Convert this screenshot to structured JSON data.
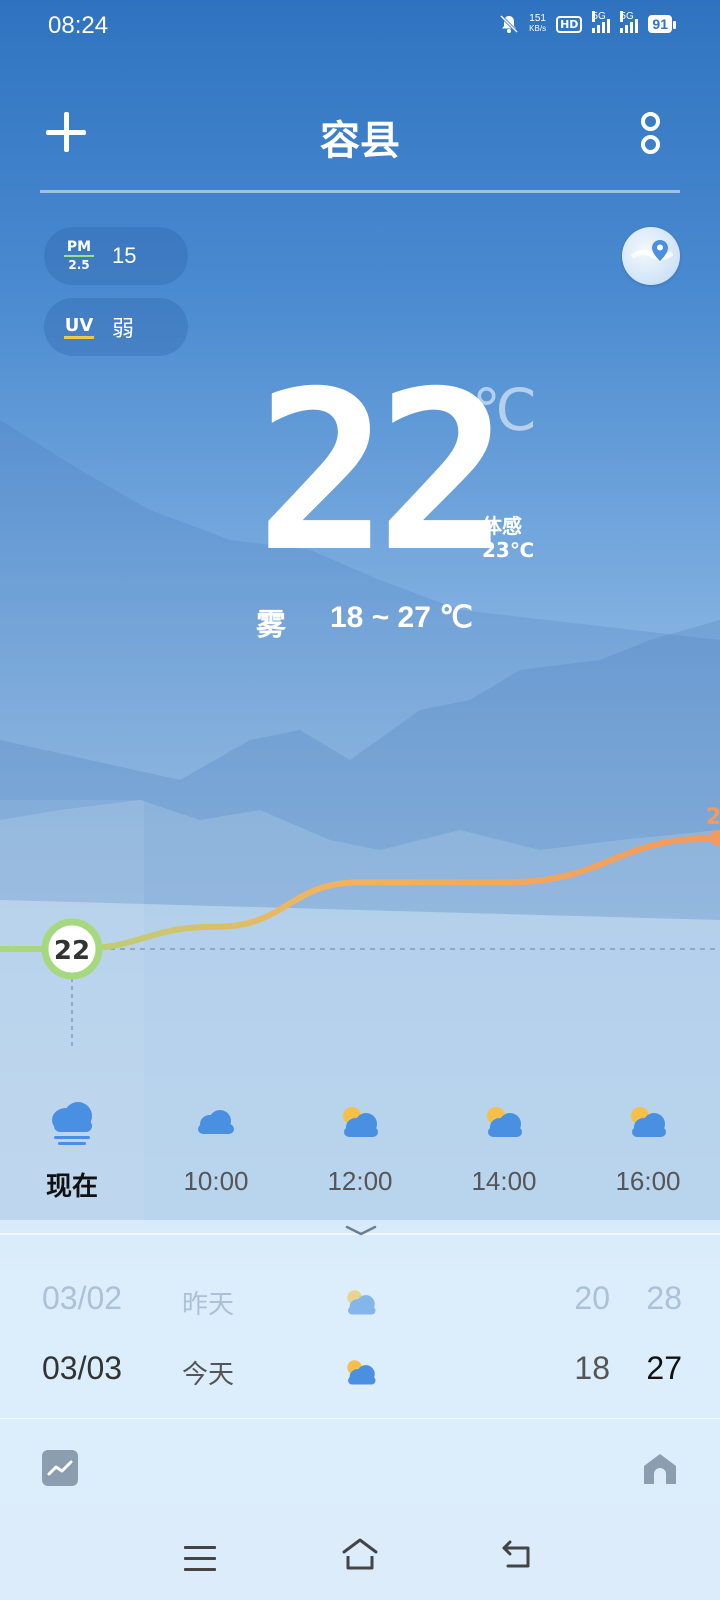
{
  "status_bar": {
    "time": "08:24",
    "net_speed_value": "151",
    "net_speed_unit": "KB/s",
    "hd_label": "HD",
    "sim1_label": "5G",
    "sim2_label": "5G",
    "battery": "91"
  },
  "header": {
    "city": "容县"
  },
  "indicators": {
    "pm_top": "PM",
    "pm_bottom": "2.5",
    "pm_value": "15",
    "uv_label": "UV",
    "uv_value": "弱"
  },
  "current": {
    "temperature": "22",
    "unit": "℃",
    "feels_label": "体感",
    "feels_value": "23℃",
    "condition": "雾",
    "range": "18 ~ 27 ℃"
  },
  "hourly": {
    "current_marker": "22",
    "next_marker_partial": "2",
    "items": [
      {
        "time": "现在",
        "icon": "fog-cloud-icon"
      },
      {
        "time": "10:00",
        "icon": "cloud-icon"
      },
      {
        "time": "12:00",
        "icon": "partly-cloudy-icon"
      },
      {
        "time": "14:00",
        "icon": "partly-cloudy-icon"
      },
      {
        "time": "16:00",
        "icon": "partly-cloudy-icon"
      }
    ],
    "temperatures": [
      22,
      23,
      25,
      25,
      27
    ]
  },
  "daily": [
    {
      "date": "03/02",
      "label": "昨天",
      "icon": "partly-cloudy-icon",
      "low": "20",
      "high": "28"
    },
    {
      "date": "03/03",
      "label": "今天",
      "icon": "partly-cloudy-icon",
      "low": "18",
      "high": "27"
    }
  ],
  "colors": {
    "accent_green": "#a6d97f",
    "accent_orange": "#f39a5c",
    "sky_top": "#2f73c0"
  }
}
